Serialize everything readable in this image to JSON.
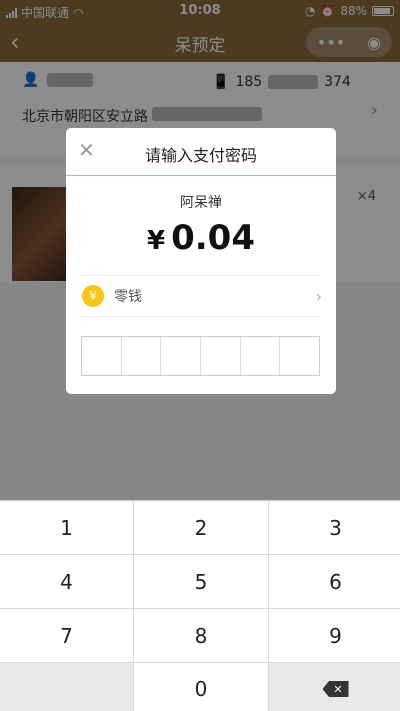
{
  "status_bar": {
    "carrier": "中国联通",
    "time": "10:08",
    "battery": "88%"
  },
  "nav": {
    "title": "呆预定",
    "more_icon": "ellipsis-icon",
    "close_icon": "target-icon"
  },
  "address": {
    "phone_prefix": "185",
    "phone_suffix": "374",
    "address_text": "北京市朝阳区安立路"
  },
  "item": {
    "quantity": "×4"
  },
  "dialog": {
    "title": "请输入支付密码",
    "merchant": "阿呆禅",
    "currency": "¥",
    "amount": "0.04",
    "method_label": "零钱",
    "coin_glyph": "¥"
  },
  "keypad": {
    "keys": [
      "1",
      "2",
      "3",
      "4",
      "5",
      "6",
      "7",
      "8",
      "9",
      "",
      "0",
      ""
    ]
  }
}
